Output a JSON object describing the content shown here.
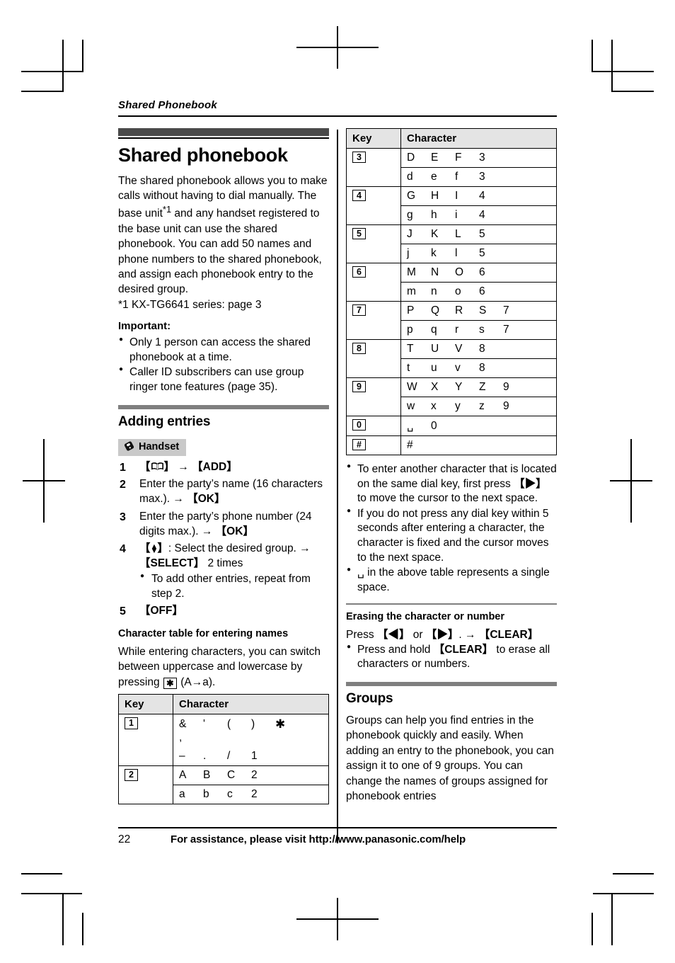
{
  "document": {
    "running_head": "Shared Phonebook",
    "page_number": "22",
    "footer_note": "For assistance, please visit http://www.panasonic.com/help"
  },
  "left_column": {
    "chapter_title": "Shared phonebook",
    "intro": "The shared phonebook allows you to make calls without having to dial manually. The base unit",
    "intro_footnote_marker": "*1",
    "intro_cont": " and any handset registered to the base unit can use the shared phonebook. You can add 50 names and phone numbers to the shared phonebook, and assign each phonebook entry to the desired group.",
    "footnote": "*1   KX-TG6641 series: page 3",
    "important_label": "Important:",
    "important_items": [
      "Only 1 person can access the shared phonebook at a time.",
      "Caller ID subscribers can use group ringer tone features (page 35)."
    ],
    "adding_entries_title": "Adding entries",
    "handset_badge": "Handset",
    "handset_icon": "handset-icon",
    "steps": [
      {
        "num": "1",
        "parts": [
          {
            "type": "key",
            "text": "【",
            "icon": "phonebook-icon",
            "close": "】"
          },
          {
            "type": "arrow",
            "text": "→"
          },
          {
            "type": "key",
            "text": "【ADD】"
          }
        ],
        "plain": ""
      },
      {
        "num": "2",
        "text_before": "Enter the party’s name (16 characters max.). ",
        "arrow": "→",
        "key": "【OK】"
      },
      {
        "num": "3",
        "text_before": "Enter the party’s phone number (24 digits max.). ",
        "arrow": "→",
        "key": "【OK】"
      },
      {
        "num": "4",
        "key_lead": "【↕】",
        "text_mid": ": Select the desired group. ",
        "arrow": "→",
        "key_after": "【SELECT】",
        "text_after": " 2 times",
        "sub_items": [
          "To add other entries, repeat from step 2."
        ]
      },
      {
        "num": "5",
        "key_only": "【OFF】"
      }
    ],
    "char_table_title": "Character table for entering names",
    "char_table_intro_a": "While entering characters, you can switch between uppercase and lowercase by pressing ",
    "char_table_intro_key": "✳",
    "char_table_intro_b": " (A→a).",
    "table": {
      "headers": [
        "Key",
        "Character"
      ],
      "rows": [
        {
          "key": "1",
          "split": false,
          "lines": [
            [
              "&",
              "'",
              "(",
              ")",
              "✳",
              ","
            ],
            [
              "–",
              ".",
              "/",
              "1"
            ]
          ]
        },
        {
          "key": "2",
          "split": true,
          "lines": [
            [
              "A",
              "B",
              "C",
              "2"
            ],
            [
              "a",
              "b",
              "c",
              "2"
            ]
          ]
        }
      ]
    }
  },
  "right_column": {
    "table": {
      "headers": [
        "Key",
        "Character"
      ],
      "rows": [
        {
          "key": "3",
          "split": true,
          "lines": [
            [
              "D",
              "E",
              "F",
              "3"
            ],
            [
              "d",
              "e",
              "f",
              "3"
            ]
          ]
        },
        {
          "key": "4",
          "split": true,
          "lines": [
            [
              "G",
              "H",
              "I",
              "4"
            ],
            [
              "g",
              "h",
              "i",
              "4"
            ]
          ]
        },
        {
          "key": "5",
          "split": true,
          "lines": [
            [
              "J",
              "K",
              "L",
              "5"
            ],
            [
              "j",
              "k",
              "l",
              "5"
            ]
          ]
        },
        {
          "key": "6",
          "split": true,
          "lines": [
            [
              "M",
              "N",
              "O",
              "6"
            ],
            [
              "m",
              "n",
              "o",
              "6"
            ]
          ]
        },
        {
          "key": "7",
          "split": true,
          "lines": [
            [
              "P",
              "Q",
              "R",
              "S",
              "7"
            ],
            [
              "p",
              "q",
              "r",
              "s",
              "7"
            ]
          ]
        },
        {
          "key": "8",
          "split": true,
          "lines": [
            [
              "T",
              "U",
              "V",
              "8"
            ],
            [
              "t",
              "u",
              "v",
              "8"
            ]
          ]
        },
        {
          "key": "9",
          "split": true,
          "lines": [
            [
              "W",
              "X",
              "Y",
              "Z",
              "9"
            ],
            [
              "w",
              "x",
              "y",
              "z",
              "9"
            ]
          ]
        },
        {
          "key": "0",
          "split": false,
          "single": true,
          "lines": [
            [
              "␣",
              "0"
            ]
          ]
        },
        {
          "key": "#",
          "split": false,
          "single": true,
          "lines": [
            [
              "#"
            ]
          ]
        }
      ]
    },
    "notes": [
      {
        "a": "To enter another character that is located on the same dial key, first press ",
        "key": "【▶】",
        "b": " to move the cursor to the next space."
      },
      {
        "a": "If you do not press any dial key within 5 seconds after entering a character, the character is fixed and the cursor moves to the next space.",
        "key": "",
        "b": ""
      },
      {
        "a": "␣ in the above table represents a single space.",
        "key": "",
        "b": ""
      }
    ],
    "erasing_title": "Erasing the character or number",
    "erasing_line": {
      "a": "Press ",
      "k1": "【◀】",
      "b": " or ",
      "k2": "【▶】",
      "c": ". ",
      "arrow": "→",
      "k3": "【CLEAR】"
    },
    "erasing_bullet": {
      "a": "Press and hold ",
      "k": "【CLEAR】",
      "b": " to erase all characters or numbers."
    },
    "groups_title": "Groups",
    "groups_text": "Groups can help you find entries in the phonebook quickly and easily. When adding an entry to the phonebook, you can assign it to one of 9 groups. You can change the names of groups assigned for phonebook entries"
  },
  "colors": {
    "chapter_bar": "#4a4a4a",
    "section_bar": "#7f7f7f",
    "badge_bg": "#c9c9c9",
    "table_header_bg": "#e4e4e4"
  }
}
